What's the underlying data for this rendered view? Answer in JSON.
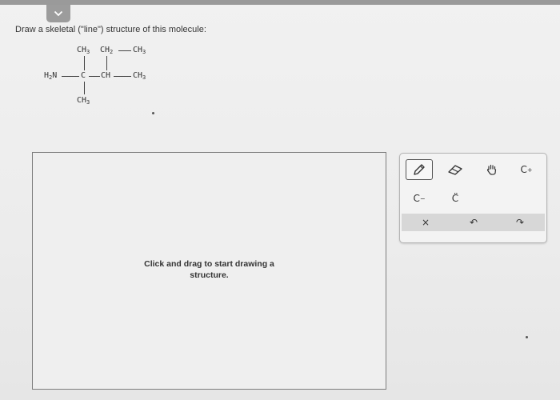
{
  "prompt": {
    "text": "Draw a skeletal (\"line\") structure of this molecule:"
  },
  "molecule": {
    "top_left": "CH3",
    "top_mid": "CH2",
    "top_right": "CH3",
    "amine": "H2N",
    "center_c": "C",
    "ch": "CH",
    "right_ch3": "CH3",
    "bottom_ch3": "CH3"
  },
  "canvas": {
    "hint_line1": "Click and drag to start drawing a",
    "hint_line2": "structure."
  },
  "toolbar": {
    "pencil": "pencil-icon",
    "eraser": "eraser-icon",
    "hand": "hand-icon",
    "carbocation": "C",
    "carbocation_charge": "+",
    "carbanion": "C",
    "carbanion_charge": "−",
    "radical": "C̈",
    "clear": "×",
    "undo": "↶",
    "redo": "↷"
  }
}
